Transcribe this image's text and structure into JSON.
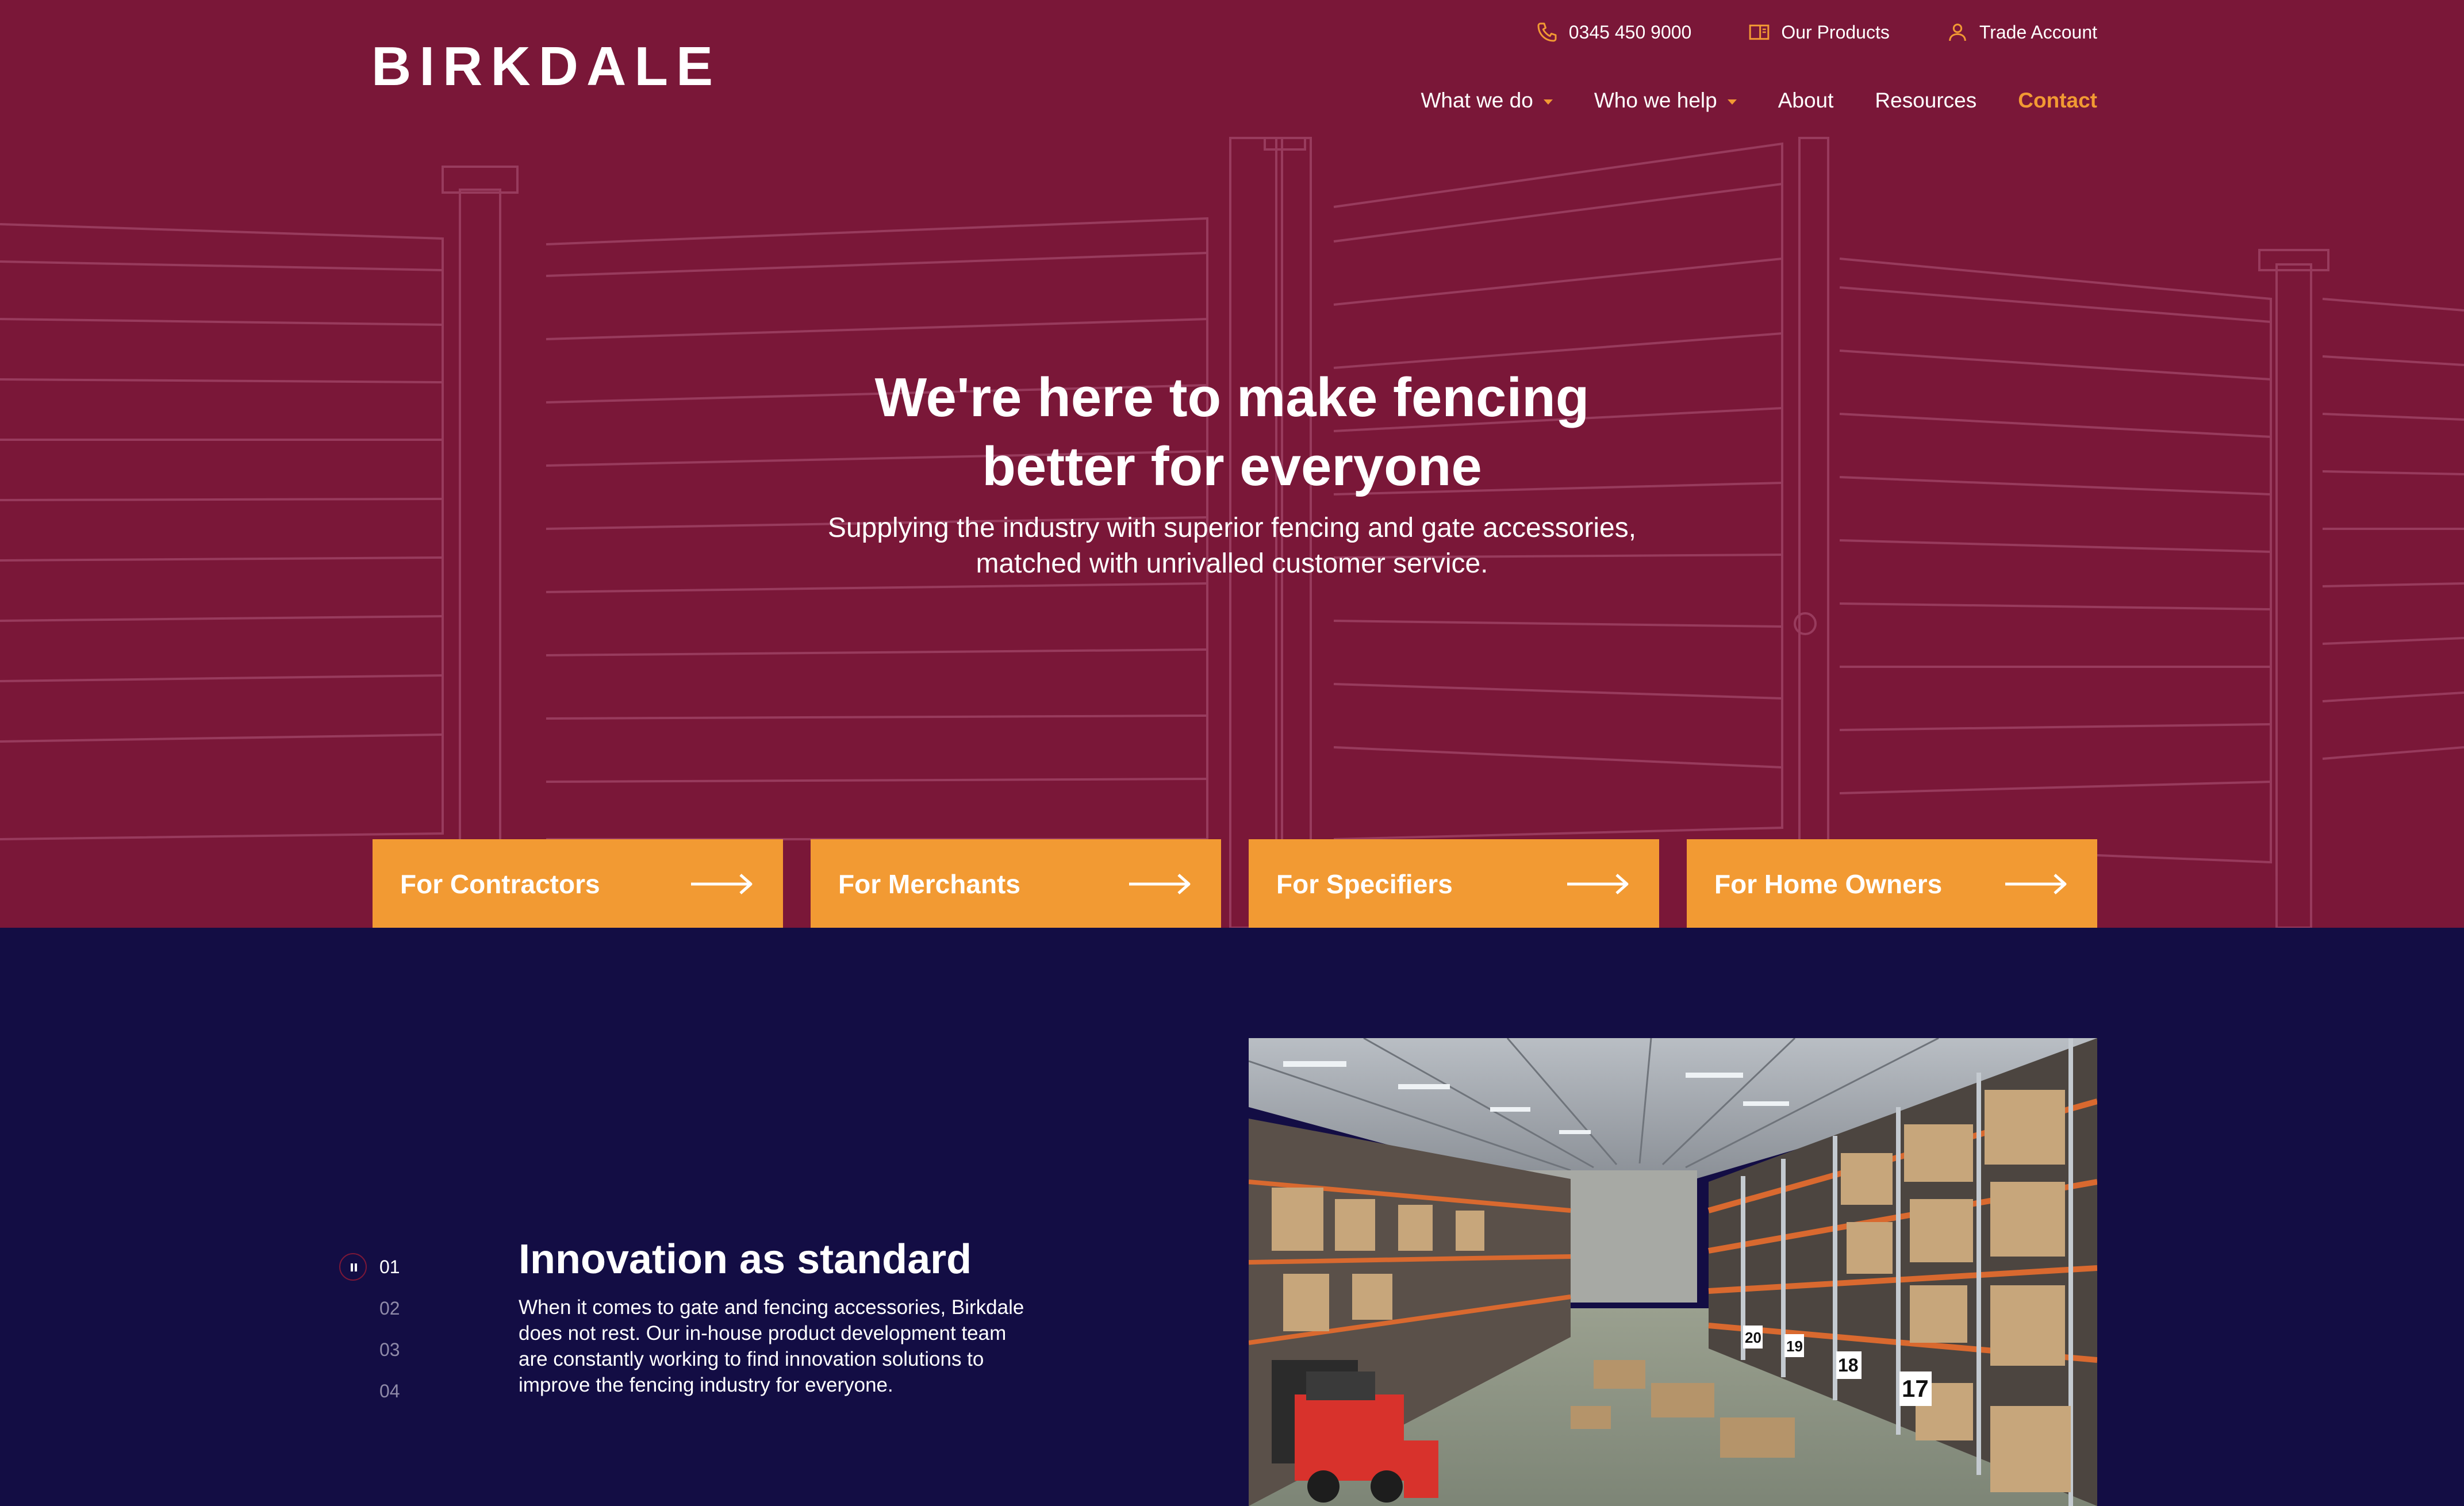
{
  "brand": {
    "logo_text": "BIRKDALE"
  },
  "colors": {
    "hero_bg": "#7a1738",
    "section_bg": "#130d44",
    "accent": "#f29a33",
    "text": "#ffffff"
  },
  "utility_nav": {
    "phone": {
      "icon": "phone-icon",
      "label": "0345 450 9000"
    },
    "products": {
      "icon": "catalogue-icon",
      "label": "Our Products"
    },
    "account": {
      "icon": "user-icon",
      "label": "Trade Account"
    }
  },
  "main_nav": {
    "items": [
      {
        "label": "What we do",
        "dropdown": true
      },
      {
        "label": "Who we help",
        "dropdown": true
      },
      {
        "label": "About",
        "dropdown": false
      },
      {
        "label": "Resources",
        "dropdown": false
      },
      {
        "label": "Contact",
        "dropdown": false
      }
    ]
  },
  "hero": {
    "title_line1": "We're here to make fencing",
    "title_line2": "better for everyone",
    "subtitle_line1": "Supplying the industry with superior fencing and gate accessories,",
    "subtitle_line2": "matched with unrivalled customer service."
  },
  "audiences": [
    {
      "label": "For Contractors",
      "icon": "arrow-right-icon"
    },
    {
      "label": "For Merchants",
      "icon": "arrow-right-icon"
    },
    {
      "label": "For Specifiers",
      "icon": "arrow-right-icon"
    },
    {
      "label": "For Home Owners",
      "icon": "arrow-right-icon"
    }
  ],
  "feature": {
    "title": "Innovation as standard",
    "text_lines": [
      "When it comes to gate and fencing accessories, Birkdale",
      "does not rest. Our in-house product development team",
      "are constantly working to find innovation solutions to",
      "improve the fencing industry for everyone."
    ],
    "image": "warehouse-photo",
    "rack_labels": [
      "20",
      "19",
      "18",
      "17"
    ]
  },
  "slider": {
    "control_icon": "pause-icon",
    "pages": [
      "01",
      "02",
      "03",
      "04"
    ],
    "active_index": 0
  }
}
